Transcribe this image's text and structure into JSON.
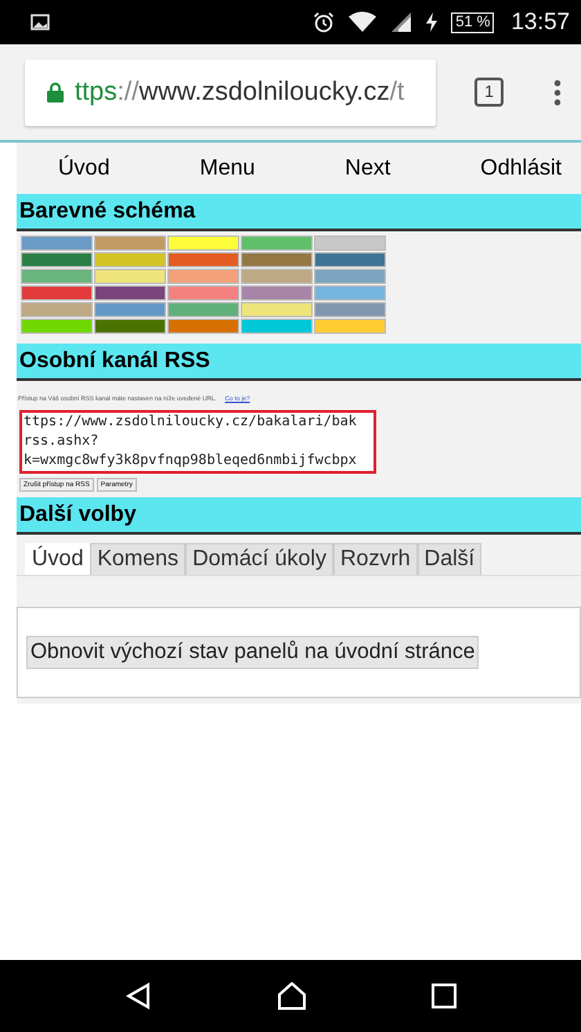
{
  "status_bar": {
    "battery": "51 %",
    "time": "13:57"
  },
  "browser": {
    "url_scheme": "ttps",
    "url_sep": "://",
    "url_host": "www.zsdolniloucky.cz",
    "url_path": "/t",
    "tab_count": "1"
  },
  "nav": [
    "Úvod",
    "Menu",
    "Next",
    "Odhlásit"
  ],
  "color_scheme": {
    "title": "Barevné schéma",
    "rows": [
      {
        "swatches": [
          {
            "color": "#6a9ac6"
          },
          {
            "color": "#c49a64"
          },
          {
            "color": "#fdfd3a"
          },
          {
            "color": "#60c06a"
          },
          {
            "color": "#c8c8c8"
          }
        ]
      },
      {
        "swatches": [
          {
            "color": "#2a7f46"
          },
          {
            "color": "#d4c424"
          },
          {
            "color": "#e45c22"
          },
          {
            "color": "#947844"
          },
          {
            "color": "#3e7496"
          }
        ]
      },
      {
        "swatches": [
          {
            "color": "#6ab47e"
          },
          {
            "color": "#eee47a"
          },
          {
            "color": "#f4a07a"
          },
          {
            "color": "#bea984"
          },
          {
            "color": "#7ca6c0"
          }
        ]
      },
      {
        "swatches": [
          {
            "color": "#e23a3a"
          },
          {
            "color": "#7a447c"
          },
          {
            "color": "#f48080"
          },
          {
            "color": "#a884a8"
          },
          {
            "color": "#74b4de"
          }
        ]
      },
      {
        "swatches": [
          {
            "color": "#bea984"
          },
          {
            "color": "#6498c6"
          },
          {
            "color": "#60b07a"
          },
          {
            "color": "#eee47a"
          },
          {
            "color": "#8098ae"
          }
        ]
      },
      {
        "swatches": [
          {
            "color": "#70d800"
          },
          {
            "color": "#4a7200"
          },
          {
            "color": "#d87000"
          },
          {
            "color": "#00c8d8"
          },
          {
            "color": "#ffcc30"
          }
        ]
      }
    ]
  },
  "rss": {
    "title": "Osobní kanál RSS",
    "info": "Přístup na Váš osobní RSS kanál máte nastaven na níže uvedené URL.",
    "info_link": "Co to je?",
    "url_lines": [
      "ttps://www.zsdolniloucky.cz/bakalari/bak",
      "rss.ashx?",
      "k=wxmgc8wfy3k8pvfnqp98bleqed6nmbijfwcbpx"
    ],
    "buttons": [
      "Zrušit přístup na RSS",
      "Parametry"
    ]
  },
  "more": {
    "title": "Další volby",
    "tabs": [
      {
        "label": "Úvod",
        "selected": true
      },
      {
        "label": "Komens",
        "selected": false
      },
      {
        "label": "Domácí úkoly",
        "selected": false
      },
      {
        "label": "Rozvrh",
        "selected": false
      },
      {
        "label": "Další",
        "selected": false
      }
    ],
    "button": "Obnovit výchozí stav panelů na úvodní stránce"
  }
}
